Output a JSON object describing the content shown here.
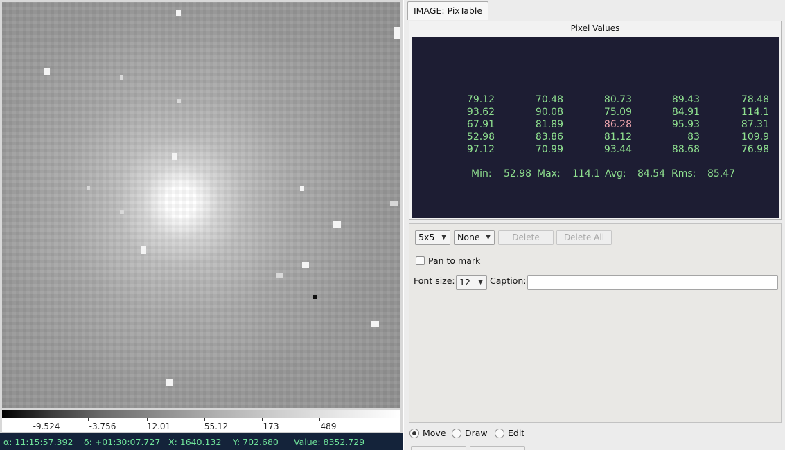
{
  "viewer": {
    "colorbar_ticks": [
      "-9.524",
      "-3.756",
      "12.01",
      "55.12",
      "173",
      "489"
    ],
    "status": {
      "ra": "α: 11:15:57.392",
      "dec": "δ: +01:30:07.727",
      "x": "X: 1640.132",
      "y": "Y: 702.680",
      "value": "Value: 8352.729"
    }
  },
  "panel": {
    "tab_label": "IMAGE: PixTable",
    "pixel_values_title": "Pixel Values",
    "pixel_grid": [
      [
        "79.12",
        "70.48",
        "80.73",
        "89.43",
        "78.48"
      ],
      [
        "93.62",
        "90.08",
        "75.09",
        "84.91",
        "114.1"
      ],
      [
        "67.91",
        "81.89",
        "86.28",
        "95.93",
        "87.31"
      ],
      [
        "52.98",
        "83.86",
        "81.12",
        "83",
        "109.9"
      ],
      [
        "97.12",
        "70.99",
        "93.44",
        "88.68",
        "76.98"
      ]
    ],
    "stats": {
      "min_label": "Min:",
      "min": "52.98",
      "max_label": "Max:",
      "max": "114.1",
      "avg_label": "Avg:",
      "avg": "84.54",
      "rms_label": "Rms:",
      "rms": "85.47"
    },
    "colors": {
      "pixel_text": "#8fe08f",
      "center_text": "#f2a8b0",
      "display_bg": "#1d1d33"
    },
    "controls": {
      "size_select": "5x5",
      "mark_select": "None",
      "delete_label": "Delete",
      "delete_all_label": "Delete All",
      "pan_to_mark_label": "Pan to mark",
      "font_size_label": "Font size:",
      "font_size_value": "12",
      "caption_label": "Caption:",
      "caption_value": ""
    },
    "modes": [
      {
        "label": "Move",
        "selected": true
      },
      {
        "label": "Draw",
        "selected": false
      },
      {
        "label": "Edit",
        "selected": false
      }
    ]
  }
}
